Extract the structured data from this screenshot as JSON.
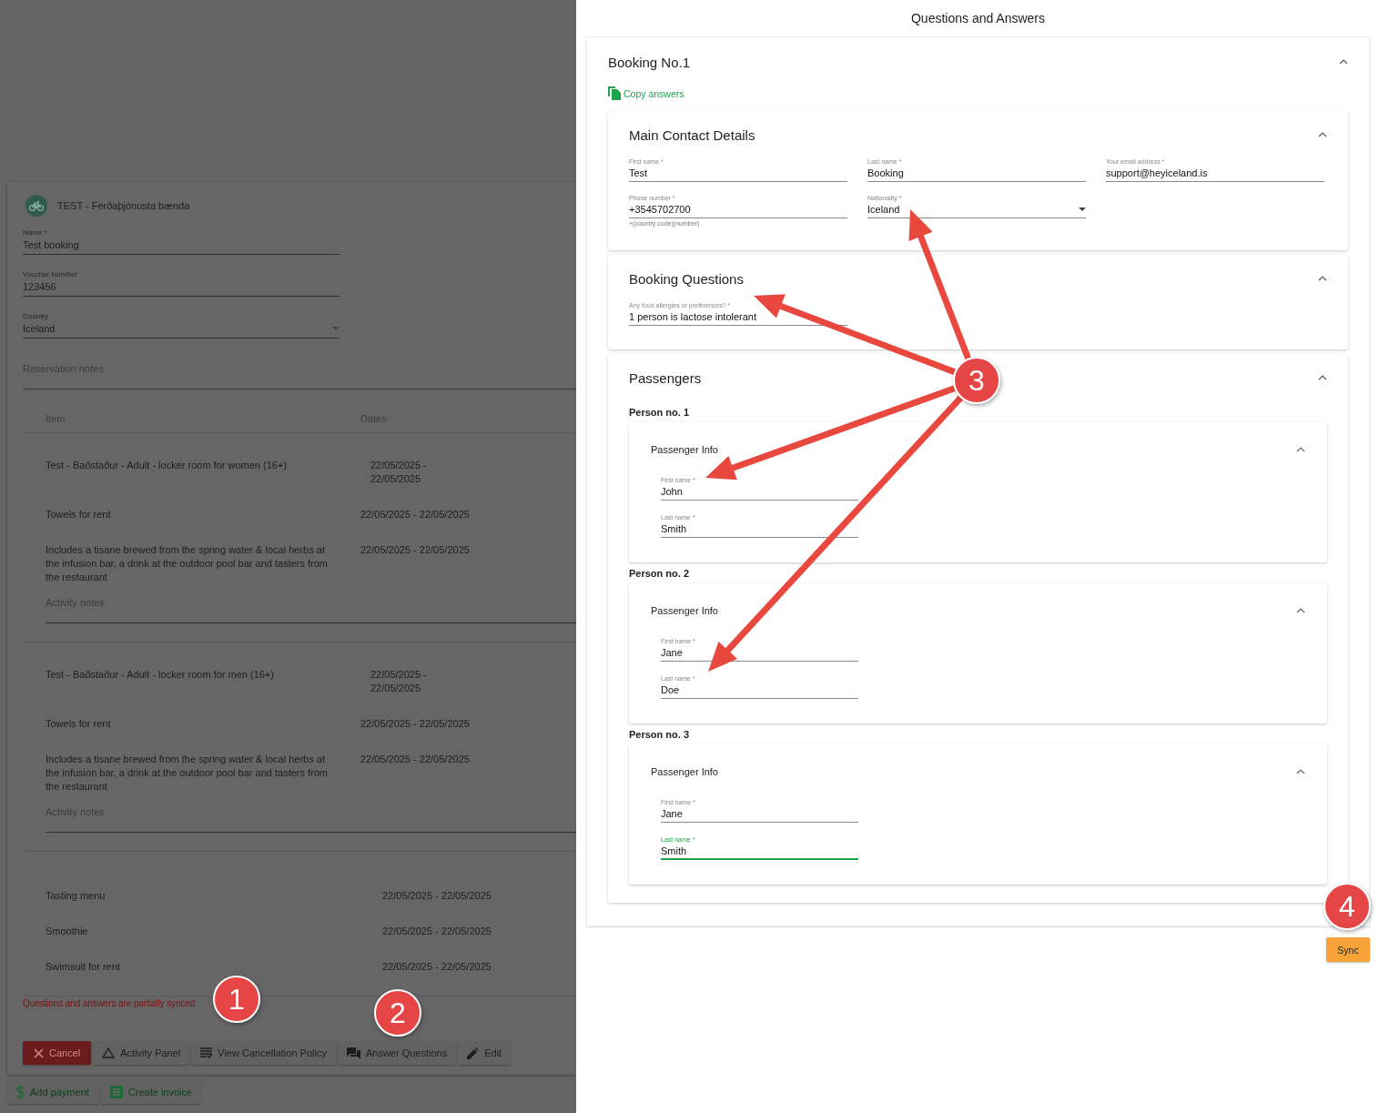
{
  "booking_page": {
    "supplier": "TEST - Ferðaþjónusta bænda",
    "fields": [
      {
        "label": "Name *",
        "value": "Test booking",
        "kind": "text"
      },
      {
        "label": "Voucher Number",
        "value": "123456",
        "kind": "text"
      },
      {
        "label": "Country",
        "value": "Iceland",
        "kind": "select"
      }
    ],
    "notes_label": "Reservation notes",
    "table": {
      "columns": [
        "Item",
        "Dates"
      ],
      "groups": [
        {
          "kind": "activity",
          "rows": [
            {
              "kind": "main",
              "item": "Test - Baðstaður - Adult - locker room for women (16+)",
              "dates": "22/05/2025 - 22/05/2025"
            },
            {
              "kind": "extra",
              "item": "Towels for rent",
              "dates": "22/05/2025 - 22/05/2025"
            },
            {
              "kind": "extra",
              "item": "Includes a tisane brewed from the spring water & local herbs at the infusion bar, a drink at the outdoor pool bar and tasters from the restaurant",
              "dates": "22/05/2025 - 22/05/2025"
            }
          ],
          "notes_label": "Activity notes"
        },
        {
          "kind": "activity",
          "rows": [
            {
              "kind": "main",
              "item": "Test - Baðstaður - Adult - locker room for men (16+)",
              "dates": "22/05/2025 - 22/05/2025"
            },
            {
              "kind": "extra",
              "item": "Towels for rent",
              "dates": "22/05/2025 - 22/05/2025"
            },
            {
              "kind": "extra",
              "item": "Includes a tisane brewed from the spring water & local herbs at the infusion bar, a drink at the outdoor pool bar and tasters from the restaurant",
              "dates": "22/05/2025 - 22/05/2025"
            }
          ],
          "notes_label": "Activity notes"
        },
        {
          "kind": "extras",
          "rows": [
            {
              "kind": "extra",
              "item": "Tasting menu",
              "dates": "22/05/2025 - 22/05/2025"
            },
            {
              "kind": "extra",
              "item": "Smoothie",
              "dates": "22/05/2025 - 22/05/2025"
            },
            {
              "kind": "extra",
              "item": "Swimsuit for rent",
              "dates": "22/05/2025 - 22/05/2025"
            }
          ]
        }
      ]
    },
    "sync_warning": "Questions and answers are partially synced",
    "actions": [
      {
        "label": "Cancel",
        "kind": "cancel"
      },
      {
        "label": "Activity Panel",
        "kind": "activity"
      },
      {
        "label": "View Cancellation Policy",
        "kind": "policy"
      },
      {
        "label": "Answer Questions",
        "kind": "questions"
      },
      {
        "label": "Edit",
        "kind": "edit"
      }
    ],
    "payment_actions": [
      {
        "label": "Add payment",
        "kind": "payment"
      },
      {
        "label": "Create invoice",
        "kind": "invoice"
      }
    ]
  },
  "drawer": {
    "title": "Questions and Answers",
    "booking": {
      "title": "Booking No.1",
      "expanded": true,
      "copy_link": "Copy answers",
      "sections": [
        {
          "kind": "contact",
          "title": "Main Contact Details",
          "expanded": true,
          "fields": [
            {
              "label": "First name *",
              "value": "Test",
              "kind": "text"
            },
            {
              "label": "Last name *",
              "value": "Booking",
              "kind": "text"
            },
            {
              "label": "Your email address *",
              "value": "support@heyiceland.is",
              "kind": "text"
            },
            {
              "label": "Phone number *",
              "value": "+3545702700",
              "kind": "text",
              "hint": "+(country code)(number)"
            },
            {
              "label": "Nationality *",
              "value": "Iceland",
              "kind": "select"
            }
          ]
        },
        {
          "kind": "questions",
          "title": "Booking Questions",
          "expanded": true,
          "fields": [
            {
              "label": "Any food allergies or preferences? *",
              "value": "1 person is lactose intolerant",
              "kind": "text"
            }
          ]
        },
        {
          "kind": "passengers",
          "title": "Passengers",
          "expanded": true,
          "persons": [
            {
              "label": "Person no. 1",
              "title": "Passenger Info",
              "expanded": true,
              "fields": [
                {
                  "label": "First name *",
                  "value": "John",
                  "kind": "text",
                  "focused": false
                },
                {
                  "label": "Last name *",
                  "value": "Smith",
                  "kind": "text",
                  "focused": false
                }
              ]
            },
            {
              "label": "Person no. 2",
              "title": "Passenger Info",
              "expanded": true,
              "fields": [
                {
                  "label": "First name *",
                  "value": "Jane",
                  "kind": "text",
                  "focused": false
                },
                {
                  "label": "Last name *",
                  "value": "Doe",
                  "kind": "text",
                  "focused": false
                }
              ]
            },
            {
              "label": "Person no. 3",
              "title": "Passenger Info",
              "expanded": true,
              "fields": [
                {
                  "label": "First name *",
                  "value": "Jane",
                  "kind": "text",
                  "focused": false
                },
                {
                  "label": "Last name *",
                  "value": "Smith",
                  "kind": "text",
                  "focused": true
                }
              ]
            }
          ]
        }
      ]
    },
    "sync_button": "Sync"
  },
  "annotations": [
    {
      "label": "1"
    },
    {
      "label": "2"
    },
    {
      "label": "3"
    },
    {
      "label": "4"
    }
  ]
}
